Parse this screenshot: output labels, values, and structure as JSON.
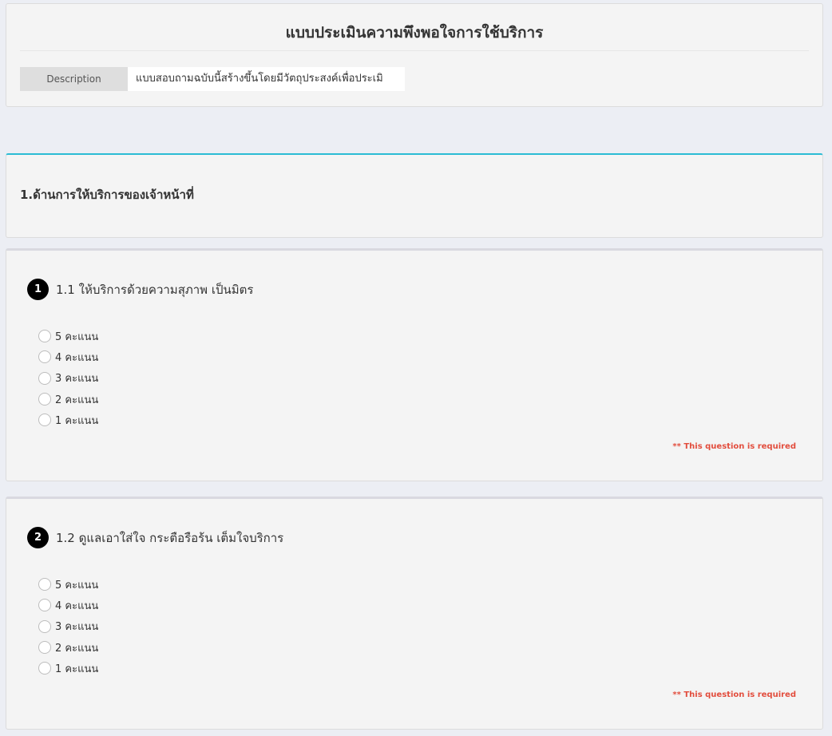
{
  "form": {
    "title": "แบบประเมินความพึงพอใจการใช้บริการ",
    "description_label": "Description",
    "description_value": "แบบสอบถามฉบับนี้สร้างขึ้นโดยมีวัตถุประสงค์เพื่อประเมิ"
  },
  "section": {
    "title": "1.ด้านการให้บริการของเจ้าหน้าที่"
  },
  "questions": [
    {
      "number": "1",
      "text": "1.1 ให้บริการด้วยความสุภาพ เป็นมิตร",
      "options": [
        "5 คะแนน",
        "4 คะแนน",
        "3 คะแนน",
        "2 คะแนน",
        "1 คะแนน"
      ],
      "required_text": "** This question is required"
    },
    {
      "number": "2",
      "text": "1.2 ดูแลเอาใส่ใจ กระตือรือร้น เต็มใจบริการ",
      "options": [
        "5 คะแนน",
        "4 คะแนน",
        "3 คะแนน",
        "2 คะแนน",
        "1 คะแนน"
      ],
      "required_text": "** This question is required"
    }
  ],
  "colors": {
    "accent": "#2bbcd4",
    "required": "#e24d3d",
    "page_background": "#eceef4",
    "panel_background": "#f4f4f4"
  }
}
